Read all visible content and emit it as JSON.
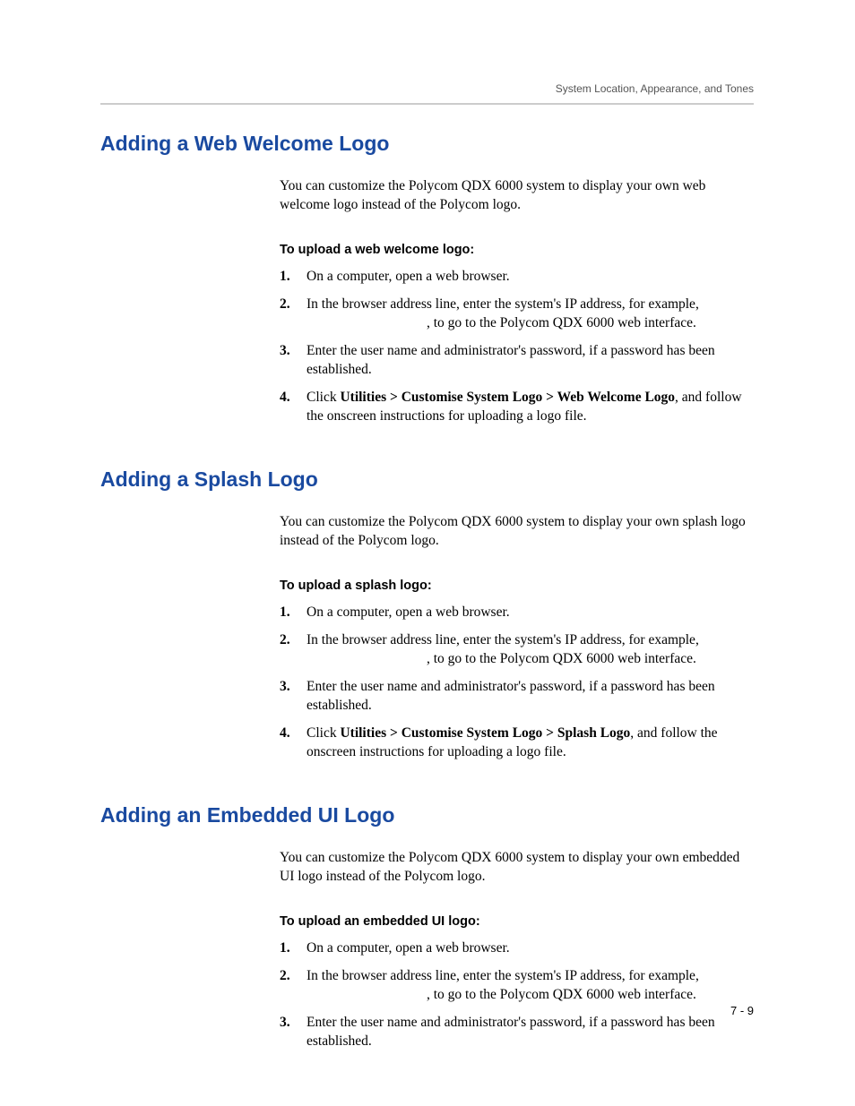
{
  "header": {
    "running": "System Location, Appearance, and Tones"
  },
  "sections": {
    "s1": {
      "title": "Adding a Web Welcome Logo",
      "intro": "You can customize the Polycom QDX 6000 system to display your own web welcome logo instead of the Polycom logo.",
      "sub": "To upload a web welcome logo:",
      "li1": "On a computer, open a web browser.",
      "li2a": "In the browser address line, enter the system's IP address, for example,",
      "li2b": ", to go to the Polycom QDX 6000 web interface.",
      "li3": "Enter the user name and administrator's password, if a password has been established.",
      "li4a": "Click ",
      "li4bold": "Utilities > Customise System Logo  > Web Welcome Logo",
      "li4b": ", and follow the onscreen instructions for uploading a logo file."
    },
    "s2": {
      "title": "Adding a Splash Logo",
      "intro": "You can customize the Polycom QDX 6000 system to display your own splash logo instead of the Polycom logo.",
      "sub": "To upload a splash logo:",
      "li1": "On a computer, open a web browser.",
      "li2a": "In the browser address line, enter the system's IP address, for example,",
      "li2b": ", to go to the Polycom QDX 6000 web interface.",
      "li3": "Enter the user name and administrator's password, if a password has been established.",
      "li4a": "Click ",
      "li4bold": "Utilities > Customise System Logo  > Splash Logo",
      "li4b": ", and follow the onscreen instructions for uploading a logo file."
    },
    "s3": {
      "title": "Adding an Embedded UI Logo",
      "intro": "You can customize the Polycom QDX 6000 system to display your own embedded UI logo instead of the Polycom logo.",
      "sub": "To upload an embedded UI logo:",
      "li1": "On a computer, open a web browser.",
      "li2a": "In the browser address line, enter the system's IP address, for example,",
      "li2b": ", to go to the Polycom QDX 6000 web interface.",
      "li3": "Enter the user name and administrator's password, if a password has been established."
    }
  },
  "nums": {
    "n1": "1.",
    "n2": "2.",
    "n3": "3.",
    "n4": "4."
  },
  "footer": {
    "page": "7 - 9"
  }
}
